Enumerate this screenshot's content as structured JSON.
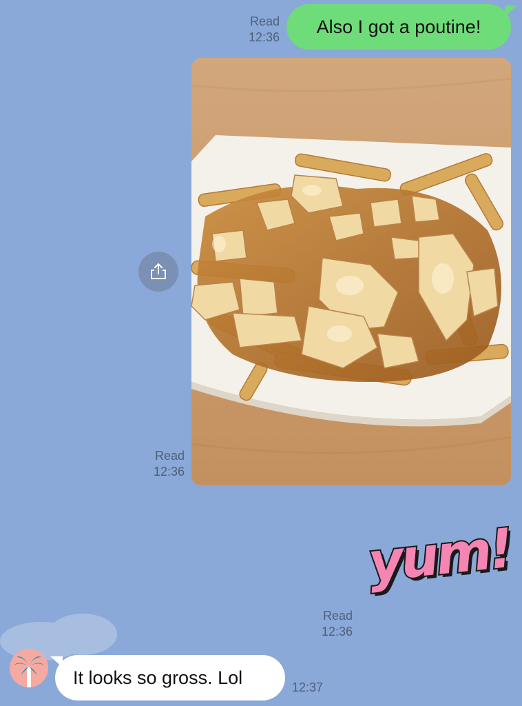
{
  "messages": {
    "out_text": {
      "text": "Also I got a poutine!",
      "status": "Read",
      "time": "12:36"
    },
    "out_photo": {
      "status": "Read",
      "time": "12:36",
      "share_icon": "share-icon"
    },
    "out_sticker": {
      "text": "yum!",
      "status": "Read",
      "time": "12:36"
    },
    "in_text": {
      "text": "It looks so gross. Lol",
      "time": "12:37",
      "avatar_icon": "palm-tree-icon"
    }
  },
  "colors": {
    "background": "#8aa9d8",
    "outgoing_bubble": "#6fdc7a",
    "incoming_bubble": "#ffffff",
    "sticker_pink": "#f585b3"
  }
}
